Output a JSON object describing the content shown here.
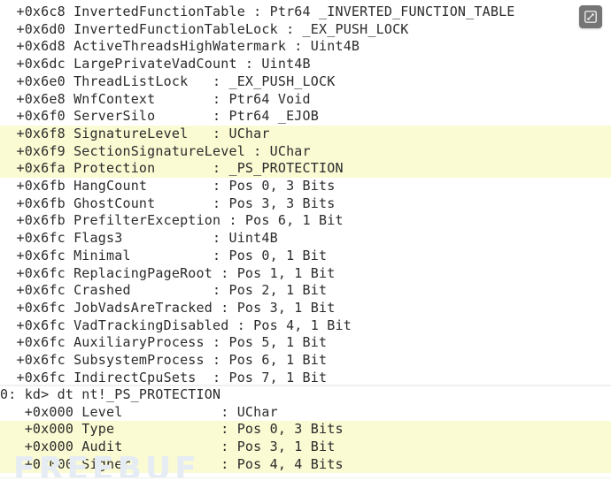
{
  "lines_top": [
    {
      "text": "  +0x6c8 InvertedFunctionTable : Ptr64 _INVERTED_FUNCTION_TABLE",
      "hl": false
    },
    {
      "text": "  +0x6d0 InvertedFunctionTableLock : _EX_PUSH_LOCK",
      "hl": false
    },
    {
      "text": "  +0x6d8 ActiveThreadsHighWatermark : Uint4B",
      "hl": false
    },
    {
      "text": "  +0x6dc LargePrivateVadCount : Uint4B",
      "hl": false
    },
    {
      "text": "  +0x6e0 ThreadListLock   : _EX_PUSH_LOCK",
      "hl": false
    },
    {
      "text": "  +0x6e8 WnfContext       : Ptr64 Void",
      "hl": false
    },
    {
      "text": "  +0x6f0 ServerSilo       : Ptr64 _EJOB",
      "hl": false
    },
    {
      "text": "  +0x6f8 SignatureLevel   : UChar",
      "hl": true
    },
    {
      "text": "  +0x6f9 SectionSignatureLevel : UChar",
      "hl": true
    },
    {
      "text": "  +0x6fa Protection       : _PS_PROTECTION",
      "hl": true
    },
    {
      "text": "  +0x6fb HangCount        : Pos 0, 3 Bits",
      "hl": false
    },
    {
      "text": "  +0x6fb GhostCount       : Pos 3, 3 Bits",
      "hl": false
    },
    {
      "text": "  +0x6fb PrefilterException : Pos 6, 1 Bit",
      "hl": false
    },
    {
      "text": "  +0x6fc Flags3           : Uint4B",
      "hl": false
    },
    {
      "text": "  +0x6fc Minimal          : Pos 0, 1 Bit",
      "hl": false
    },
    {
      "text": "  +0x6fc ReplacingPageRoot : Pos 1, 1 Bit",
      "hl": false
    },
    {
      "text": "  +0x6fc Crashed          : Pos 2, 1 Bit",
      "hl": false
    },
    {
      "text": "  +0x6fc JobVadsAreTracked : Pos 3, 1 Bit",
      "hl": false
    },
    {
      "text": "  +0x6fc VadTrackingDisabled : Pos 4, 1 Bit",
      "hl": false
    },
    {
      "text": "  +0x6fc AuxiliaryProcess : Pos 5, 1 Bit",
      "hl": false
    },
    {
      "text": "  +0x6fc SubsystemProcess : Pos 6, 1 Bit",
      "hl": false
    },
    {
      "text": "  +0x6fc IndirectCpuSets  : Pos 7, 1 Bit",
      "hl": false
    }
  ],
  "lines_bottom": [
    {
      "text": "0: kd> dt nt!_PS_PROTECTION",
      "hl": false
    },
    {
      "text": "   +0x000 Level            : UChar",
      "hl": false
    },
    {
      "text": "   +0x000 Type             : Pos 0, 3 Bits",
      "hl": true
    },
    {
      "text": "   +0x000 Audit            : Pos 3, 1 Bit",
      "hl": true
    },
    {
      "text": "   +0x000 Signer           : Pos 4, 4 Bits",
      "hl": true
    }
  ],
  "watermark": "FREEBUF",
  "icons": {
    "expand": "expand-icon"
  },
  "colors": {
    "highlight": "#fafad3",
    "button": "#757575"
  }
}
